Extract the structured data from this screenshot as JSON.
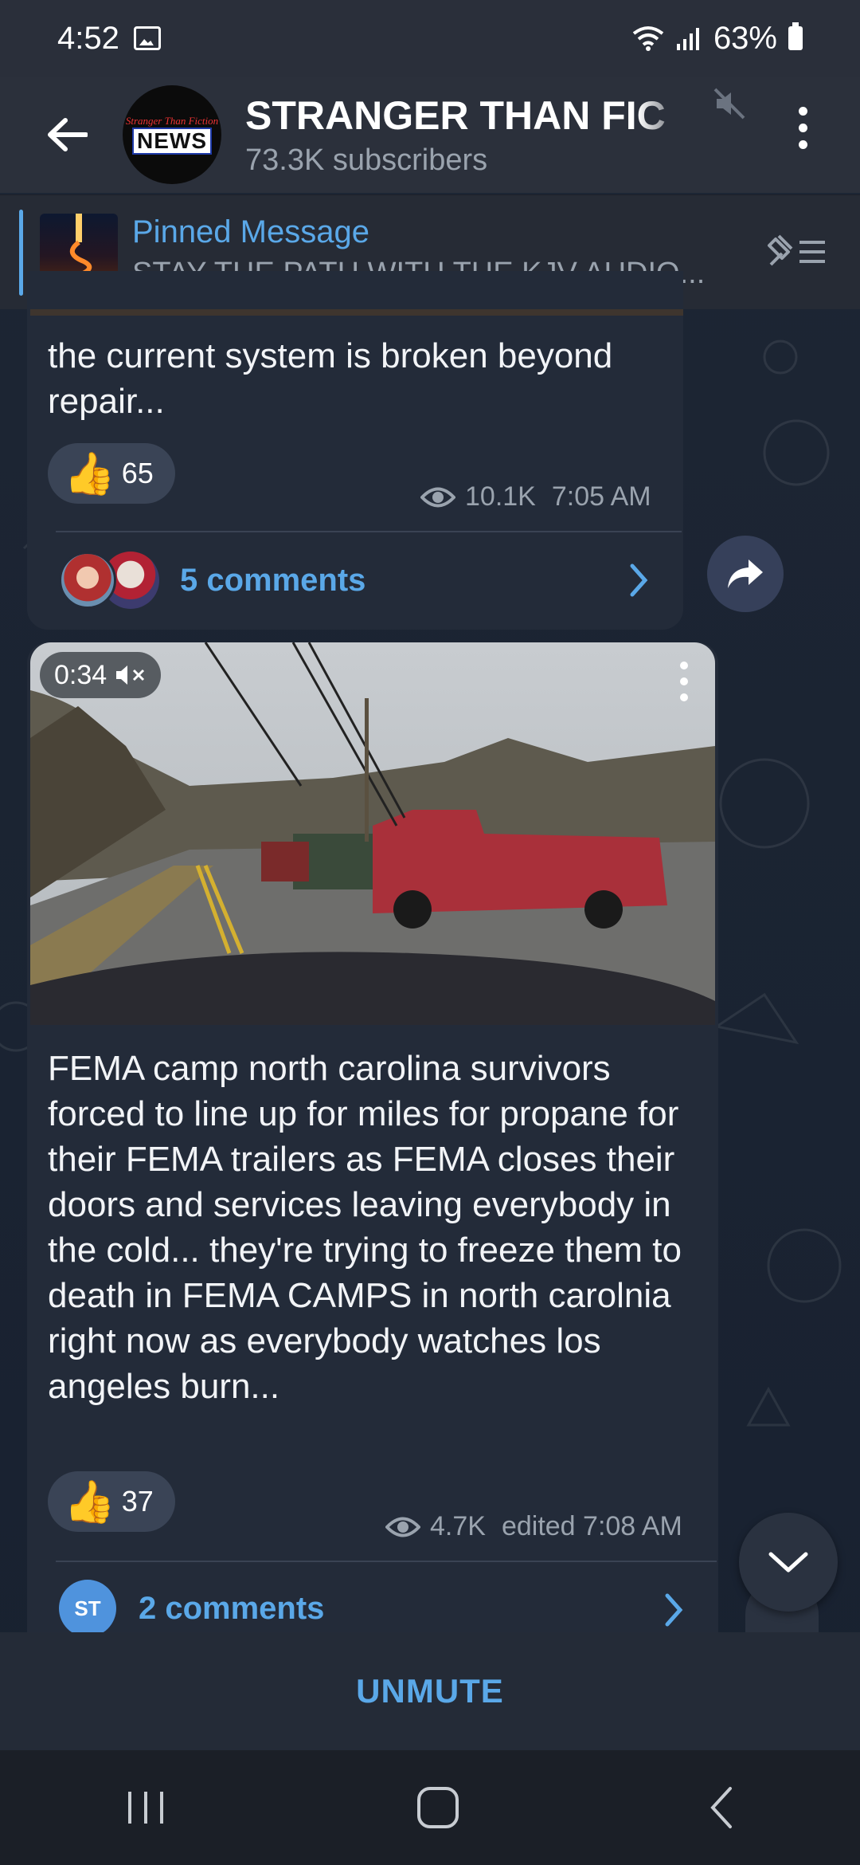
{
  "status_bar": {
    "time": "4:52",
    "battery": "63%"
  },
  "header": {
    "title": "STRANGER THAN FIC",
    "subtitle": "73.3K subscribers",
    "avatar_top": "Stranger Than Fiction",
    "avatar_main": "NEWS"
  },
  "pinned": {
    "title": "Pinned Message",
    "text": "STAY THE PATH WITH THE KJV AUDIO..."
  },
  "message1": {
    "text": "the current system is broken beyond repair...",
    "reaction_count": "65",
    "views": "10.1K",
    "time": "7:05 AM",
    "comments": "5 comments"
  },
  "message2": {
    "video_duration": "0:34",
    "text": "FEMA camp north carolina survivors forced to line up for miles for propane for their FEMA trailers as FEMA closes their doors and services leaving everybody in the cold... they're trying to freeze them to death in FEMA CAMPS in north carolnia right now as everybody watches los angeles burn...",
    "reaction_count": "37",
    "views": "4.7K",
    "time": "edited 7:08 AM",
    "comments": "2 comments",
    "commenter_initials": "ST"
  },
  "bottom": {
    "unmute_label": "UNMUTE"
  },
  "colors": {
    "accent": "#5aa8e8",
    "bubble": "#232b39",
    "background": "#1a2230"
  }
}
